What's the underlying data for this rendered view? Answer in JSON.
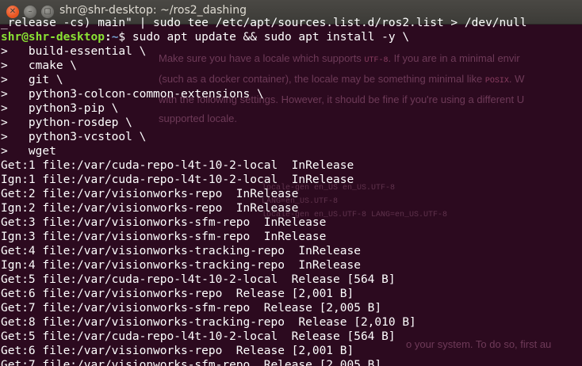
{
  "window": {
    "title": "shr@shr-desktop: ~/ros2_dashing"
  },
  "background_page": {
    "para1_line1_a": "Make sure you have a locale which supports",
    "para1_code1": "UTF-8",
    "para1_line1_b": ". If you are in a minimal envir",
    "para1_line2_a": "(such as a docker container), the locale may be something minimal like",
    "para1_code2": "POSIX",
    "para1_line2_b": ". W",
    "para1_line3": "with the following settings. However, it should be fine if you're using a different U",
    "para1_line4": "supported locale.",
    "code1": "locale-gen en_US en_US.UTF-8",
    "code2": "LANG=en_US.UTF-8",
    "code3": "locale-gen en_US.UTF-8 LANG=en_US.UTF-8",
    "para2": "o your system. To do so, first au"
  },
  "terminal": {
    "top_partial": "_release -cs) main\" | sudo tee /etc/apt/sources.list.d/ros2.list > /dev/null",
    "prompt": {
      "user_host": "shr@shr-desktop",
      "sep": ":",
      "path": "~",
      "symbol": "$",
      "command": " sudo apt update && sudo apt install -y \\"
    },
    "lines": [
      ">   build-essential \\",
      ">   cmake \\",
      ">   git \\",
      ">   python3-colcon-common-extensions \\",
      ">   python3-pip \\",
      ">   python-rosdep \\",
      ">   python3-vcstool \\",
      ">   wget",
      "Get:1 file:/var/cuda-repo-l4t-10-2-local  InRelease",
      "Ign:1 file:/var/cuda-repo-l4t-10-2-local  InRelease",
      "Get:2 file:/var/visionworks-repo  InRelease",
      "Ign:2 file:/var/visionworks-repo  InRelease",
      "Get:3 file:/var/visionworks-sfm-repo  InRelease",
      "Ign:3 file:/var/visionworks-sfm-repo  InRelease",
      "Get:4 file:/var/visionworks-tracking-repo  InRelease",
      "Ign:4 file:/var/visionworks-tracking-repo  InRelease",
      "Get:5 file:/var/cuda-repo-l4t-10-2-local  Release [564 B]",
      "Get:6 file:/var/visionworks-repo  Release [2,001 B]",
      "Get:7 file:/var/visionworks-sfm-repo  Release [2,005 B]",
      "Get:8 file:/var/visionworks-tracking-repo  Release [2,010 B]",
      "Get:5 file:/var/cuda-repo-l4t-10-2-local  Release [564 B]",
      "Get:6 file:/var/visionworks-repo  Release [2,001 B]",
      "Get:7 file:/var/visionworks-sfm-repo  Release [2,005 B]"
    ]
  },
  "colors": {
    "terminal_bg": "#2c0a1f",
    "prompt_user": "#8ae234",
    "prompt_path": "#729fcf",
    "close_button": "#e95420"
  }
}
